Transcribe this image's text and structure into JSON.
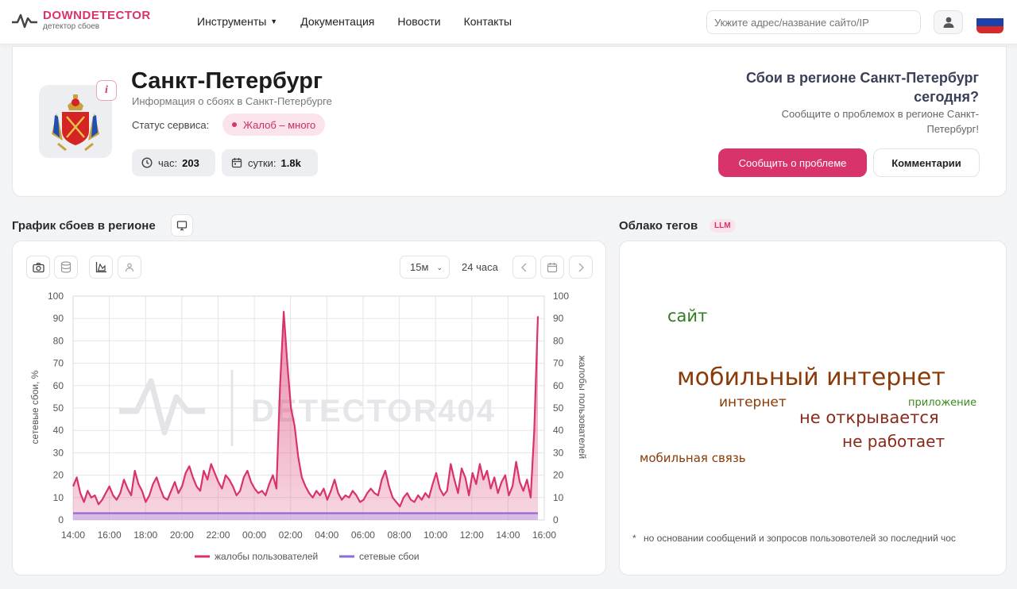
{
  "header": {
    "logo_name_1": "DOWN",
    "logo_name_2": "DETECTOR",
    "logo_sub": "детектор сбоев",
    "nav": [
      "Инструменты",
      "Документация",
      "Новости",
      "Контакты"
    ],
    "search_placeholder": "Укжите адрес/название сайто/IP",
    "flag_colors": [
      "#ffffff",
      "#1c3fa8",
      "#d42a2a"
    ]
  },
  "city": {
    "title": "Санкт-Петербург",
    "subtitle": "Информация о сбоях в Санкт-Петербурге",
    "status_label": "Статус сервиса:",
    "status_value": "Жалоб – много",
    "stat_hour_label": "час:",
    "stat_hour_value": "203",
    "stat_day_label": "сутки:",
    "stat_day_value": "1.8k",
    "region_title": "Сбои в регионе Санкт-Петербург сегодня?",
    "region_sub": "Сообщите о проблемох в регионе Санкт-Петербург!",
    "report_button": "Сообщить о проблеме",
    "comments_button": "Комментарии"
  },
  "chart_section": {
    "title": "График сбоев в регионе",
    "interval": "15м",
    "period": "24 часа",
    "watermark": "DETECTOR404"
  },
  "cloud_section": {
    "title": "Облако тегов",
    "badge": "LLM",
    "tags": [
      {
        "text": "сайт",
        "color": "#2e7d1f"
      },
      {
        "text": "мобильный интернет",
        "color": "#8a3a08"
      },
      {
        "text": "интернет",
        "color": "#8a3a08"
      },
      {
        "text": "приложение",
        "color": "#3b8a1d"
      },
      {
        "text": "не открывается",
        "color": "#8a2a1a"
      },
      {
        "text": "не работает",
        "color": "#8a2a1a"
      },
      {
        "text": "мобильная связь",
        "color": "#8a3a08"
      }
    ],
    "footnote_star": "*",
    "footnote": "но основании сообщений и зопросов пользовотелей зо последний чос"
  },
  "chart_data": {
    "type": "area",
    "ylabel_left": "сетевые сбои, %",
    "ylabel_right": "жалобы пользователей",
    "ylim": [
      0,
      100
    ],
    "yticks": [
      0,
      10,
      20,
      30,
      40,
      50,
      60,
      70,
      80,
      90,
      100
    ],
    "x_tick_labels": [
      "14:00",
      "16:00",
      "18:00",
      "20:00",
      "22:00",
      "00:00",
      "02:00",
      "04:00",
      "06:00",
      "08:00",
      "10:00",
      "12:00",
      "14:00",
      "16:00"
    ],
    "grid": true,
    "legend_position": "bottom",
    "series": [
      {
        "name": "жалобы пользователей",
        "color": "#d9336b",
        "values": [
          15,
          19,
          12,
          8,
          13,
          10,
          11,
          7,
          9,
          12,
          15,
          11,
          9,
          12,
          18,
          14,
          11,
          22,
          16,
          13,
          8,
          11,
          16,
          19,
          14,
          10,
          9,
          13,
          17,
          12,
          15,
          21,
          24,
          19,
          15,
          13,
          22,
          18,
          25,
          21,
          17,
          14,
          20,
          18,
          15,
          11,
          13,
          19,
          22,
          17,
          14,
          12,
          13,
          11,
          16,
          20,
          14,
          60,
          93,
          70,
          50,
          42,
          28,
          19,
          15,
          12,
          10,
          13,
          11,
          14,
          9,
          13,
          18,
          12,
          9,
          11,
          10,
          13,
          11,
          8,
          9,
          12,
          14,
          12,
          11,
          18,
          22,
          15,
          10,
          8,
          6,
          10,
          12,
          9,
          8,
          11,
          9,
          12,
          10,
          16,
          21,
          14,
          11,
          13,
          25,
          18,
          12,
          23,
          19,
          11,
          21,
          16,
          25,
          18,
          22,
          14,
          19,
          12,
          17,
          20,
          11,
          15,
          26,
          17,
          13,
          18,
          10,
          40,
          91
        ]
      },
      {
        "name": "сетевые сбои",
        "color": "#8e6bd8",
        "values": [
          3,
          3,
          3,
          3,
          3,
          3,
          3,
          3,
          3,
          3,
          3,
          3,
          3,
          3,
          3,
          3,
          3,
          3,
          3,
          3,
          3,
          3,
          3,
          3,
          3,
          3,
          3,
          3,
          3,
          3,
          3,
          3,
          3,
          3,
          3,
          3,
          3,
          3,
          3,
          3,
          3,
          3,
          3,
          3,
          3,
          3,
          3,
          3,
          3,
          3,
          3,
          3,
          3,
          3,
          3,
          3,
          3,
          3,
          3,
          3,
          3,
          3,
          3,
          3,
          3,
          3,
          3,
          3,
          3,
          3,
          3,
          3,
          3,
          3,
          3,
          3,
          3,
          3,
          3,
          3,
          3,
          3,
          3,
          3,
          3,
          3,
          3,
          3,
          3,
          3,
          3,
          3,
          3,
          3,
          3,
          3,
          3,
          3,
          3,
          3,
          3,
          3,
          3,
          3,
          3,
          3,
          3,
          3,
          3,
          3,
          3,
          3,
          3,
          3,
          3,
          3,
          3,
          3,
          3,
          3,
          3,
          3,
          3,
          3,
          3,
          3,
          3,
          3,
          3
        ]
      }
    ]
  }
}
